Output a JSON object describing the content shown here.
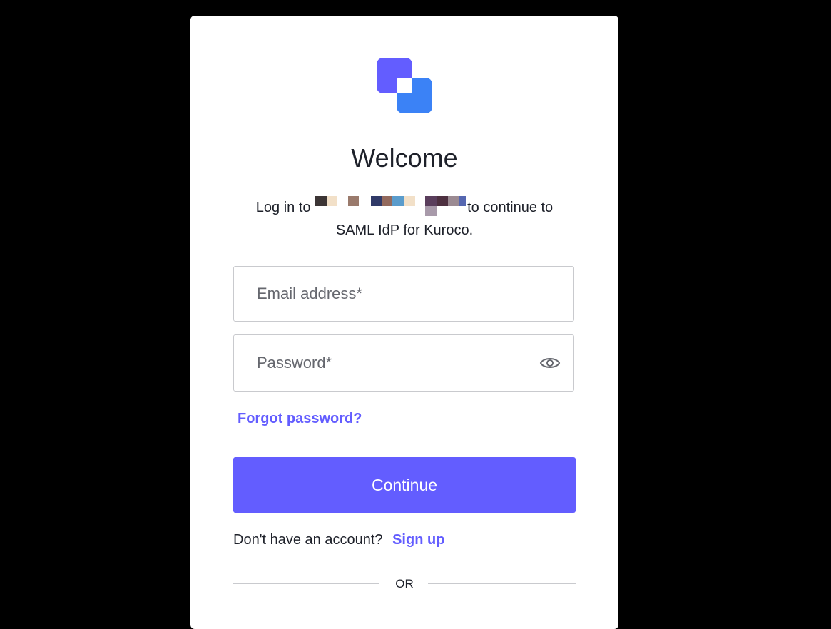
{
  "brand": {
    "logo_icon": "kuroco-logo-icon",
    "logo_colors": [
      "#635dff",
      "#3b82f6",
      "#ffffff"
    ]
  },
  "header": {
    "title": "Welcome",
    "subtitle_prefix": "Log in to",
    "subtitle_suffix": "to continue to SAML IdP for Kuroco."
  },
  "form": {
    "email_placeholder": "Email address*",
    "email_value": "",
    "password_placeholder": "Password*",
    "password_value": "",
    "show_password_icon": "eye-icon",
    "forgot_password": "Forgot password?",
    "continue_label": "Continue"
  },
  "signup": {
    "prompt": "Don't have an account?",
    "link": "Sign up"
  },
  "divider": {
    "label": "OR"
  },
  "colors": {
    "accent": "#635dff",
    "text": "#1e212a",
    "border": "#c9cace",
    "background": "#000000"
  }
}
